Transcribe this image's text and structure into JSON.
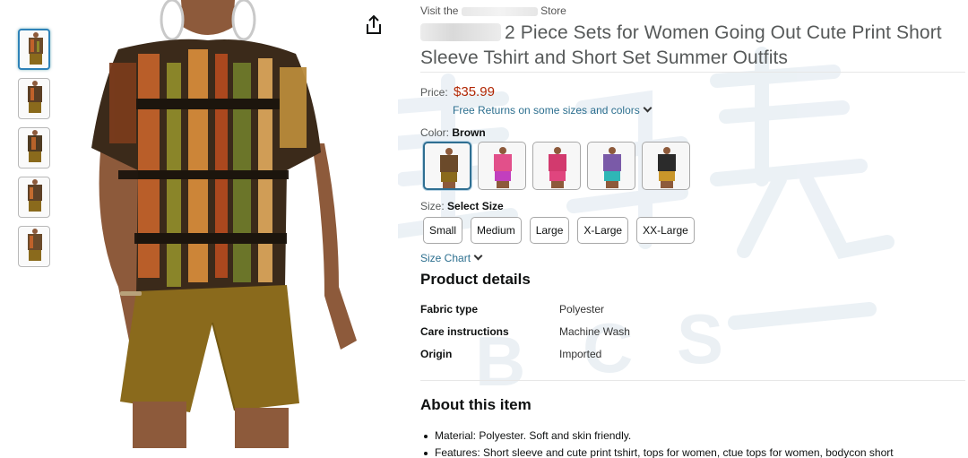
{
  "store": {
    "link_prefix": "Visit the",
    "link_suffix": "Store"
  },
  "product": {
    "title": "2 Piece Sets for Women Going Out Cute Print Short Sleeve Tshirt and Short Set Summer Outfits",
    "price_label": "Price:",
    "price": "$35.99",
    "free_returns": "Free Returns on some sizes and colors",
    "color_label": "Color:",
    "color_selected": "Brown",
    "size_label": "Size:",
    "size_selected": "Select Size",
    "sizes": [
      "Small",
      "Medium",
      "Large",
      "X-Large",
      "XX-Large"
    ],
    "size_chart": "Size Chart"
  },
  "details": {
    "heading": "Product details",
    "rows": [
      {
        "key": "Fabric type",
        "value": "Polyester"
      },
      {
        "key": "Care instructions",
        "value": "Machine Wash"
      },
      {
        "key": "Origin",
        "value": "Imported"
      }
    ]
  },
  "about": {
    "heading": "About this item",
    "bullets": [
      "Material: Polyester. Soft and skin friendly.",
      "Features: Short sleeve and cute print tshirt, tops for women, ctue tops for women, bodycon short"
    ]
  },
  "swatches": [
    {
      "top": "#6b4a2a",
      "bottom": "#8a6a1c"
    },
    {
      "top": "#e2508a",
      "bottom": "#c23fbe"
    },
    {
      "top": "#d23a6e",
      "bottom": "#e0457e"
    },
    {
      "top": "#7a5aa8",
      "bottom": "#2fb6b6"
    },
    {
      "top": "#2b2b2b",
      "bottom": "#c9962a"
    }
  ],
  "colors": {
    "link": "#2c6f8f",
    "price": "#b12704",
    "selected_border": "#2f6f92",
    "shorts": "#8a6a1c"
  },
  "icons": {
    "share": "share-icon",
    "chevron": "chevron-down-icon"
  }
}
